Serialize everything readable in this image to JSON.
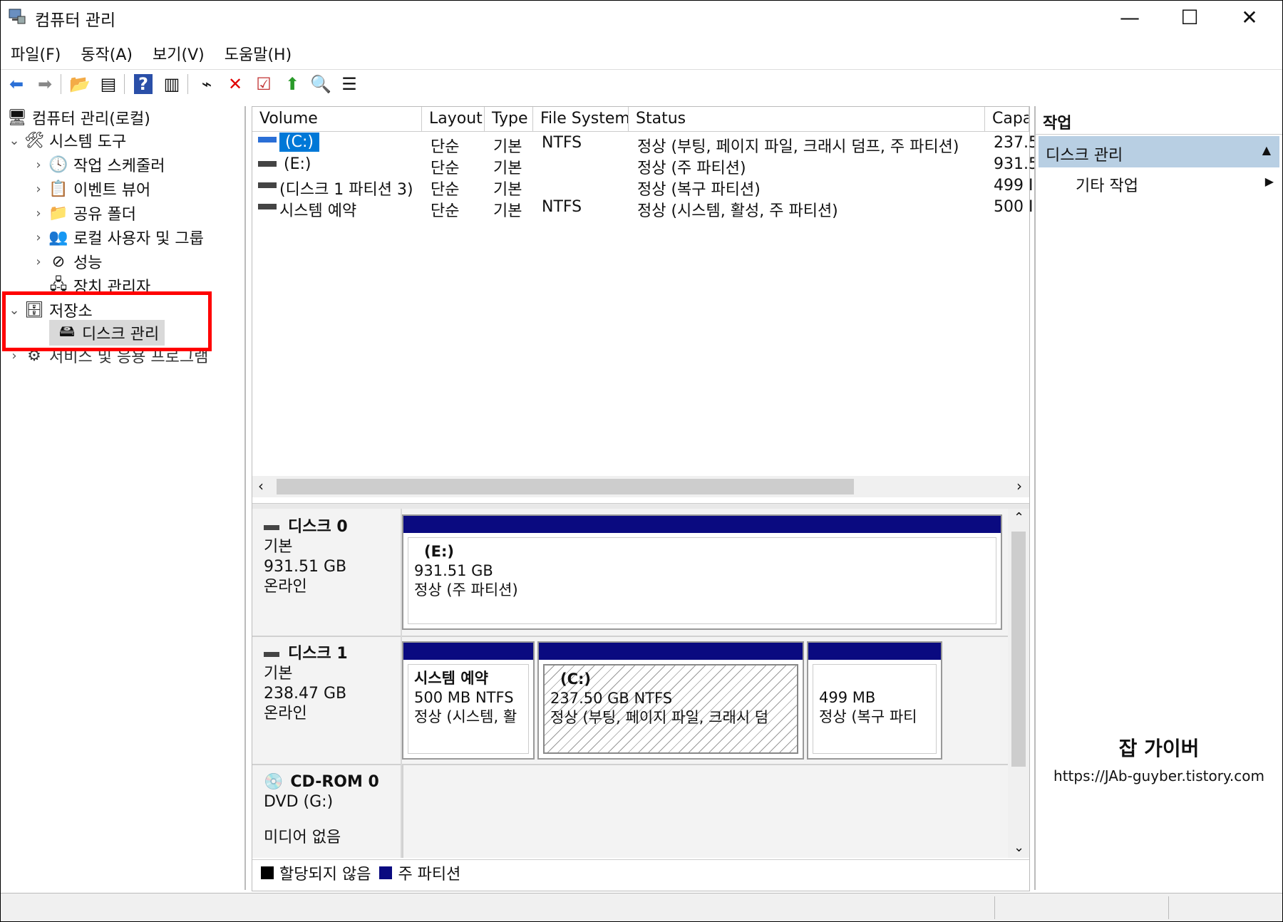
{
  "window": {
    "title": "컴퓨터 관리",
    "minimize": "—",
    "maximize": "☐",
    "close": "✕"
  },
  "menu": [
    "파일(F)",
    "동작(A)",
    "보기(V)",
    "도움말(H)"
  ],
  "tree": {
    "root": "컴퓨터 관리(로컬)",
    "system_tools": "시스템 도구",
    "task_scheduler": "작업 스케줄러",
    "event_viewer": "이벤트 뷰어",
    "shared_folders": "공유 폴더",
    "local_users": "로컬 사용자 및 그룹",
    "performance": "성능",
    "device_manager": "장치 관리자",
    "storage": "저장소",
    "disk_management": "디스크 관리",
    "services": "서비스 및 응용 프로그램"
  },
  "volume_list": {
    "columns": [
      "Volume",
      "Layout",
      "Type",
      "File System",
      "Status",
      "Capa"
    ],
    "rows": [
      {
        "volume": "(C:)",
        "layout": "단순",
        "type": "기본",
        "fs": "NTFS",
        "status": "정상 (부팅, 페이지 파일, 크래시 덤프, 주 파티션)",
        "capacity": "237.5"
      },
      {
        "volume": "(E:)",
        "layout": "단순",
        "type": "기본",
        "fs": "",
        "status": "정상 (주 파티션)",
        "capacity": "931.5"
      },
      {
        "volume": "(디스크 1 파티션 3)",
        "layout": "단순",
        "type": "기본",
        "fs": "",
        "status": "정상 (복구 파티션)",
        "capacity": "499 I"
      },
      {
        "volume": "시스템 예약",
        "layout": "단순",
        "type": "기본",
        "fs": "NTFS",
        "status": "정상 (시스템, 활성, 주 파티션)",
        "capacity": "500 I"
      }
    ]
  },
  "disks": {
    "disk0": {
      "name": "디스크 0",
      "type": "기본",
      "size": "931.51 GB",
      "state": "온라인",
      "p1": {
        "label": "(E:)",
        "size": "931.51 GB",
        "status": "정상 (주 파티션)"
      }
    },
    "disk1": {
      "name": "디스크 1",
      "type": "기본",
      "size": "238.47 GB",
      "state": "온라인",
      "p1": {
        "label": "시스템 예약",
        "size": "500 MB NTFS",
        "status": "정상 (시스템, 활"
      },
      "p2": {
        "label": "(C:)",
        "size": "237.50 GB NTFS",
        "status": "정상 (부팅, 페이지 파일, 크래시 덤"
      },
      "p3": {
        "size": "499 MB",
        "status": "정상 (복구 파티"
      }
    },
    "cdrom0": {
      "name": "CD-ROM 0",
      "drive": "DVD (G:)",
      "media": "미디어 없음"
    }
  },
  "legend": {
    "unallocated": "할당되지 않음",
    "primary": "주 파티션"
  },
  "actions": {
    "header": "작업",
    "section": "디스크 관리",
    "more": "기타 작업"
  },
  "watermark": {
    "title": "잡 가이버",
    "url": "https://JAb-guyber.tistory.com"
  },
  "colors": {
    "partition_header": "#0a0a80",
    "selection": "#0078d7",
    "highlight": "#ff0000",
    "action_section": "#b8cfe3"
  }
}
